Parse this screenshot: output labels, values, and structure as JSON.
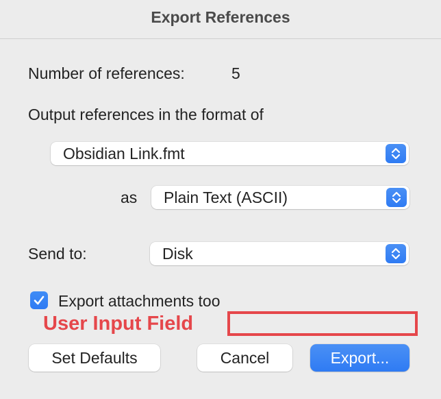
{
  "window": {
    "title": "Export References"
  },
  "count": {
    "label": "Number of references:",
    "value": "5"
  },
  "format": {
    "label": "Output references in the format of",
    "style_selected": "Obsidian Link.fmt",
    "as_label": "as",
    "encoding_selected": "Plain Text (ASCII)"
  },
  "send_to": {
    "label": "Send to:",
    "selected": "Disk"
  },
  "attachments": {
    "label": "Export attachments too",
    "checked": true
  },
  "annotation": {
    "label": "User Input Field",
    "value": ""
  },
  "buttons": {
    "set_defaults": "Set Defaults",
    "cancel": "Cancel",
    "export": "Export..."
  },
  "icons": {
    "stepper": "chevron-up-down-icon",
    "checkmark": "checkmark-icon"
  },
  "colors": {
    "accent": "#2f7bf3",
    "annotation": "#e5474b",
    "background": "#ececec"
  }
}
